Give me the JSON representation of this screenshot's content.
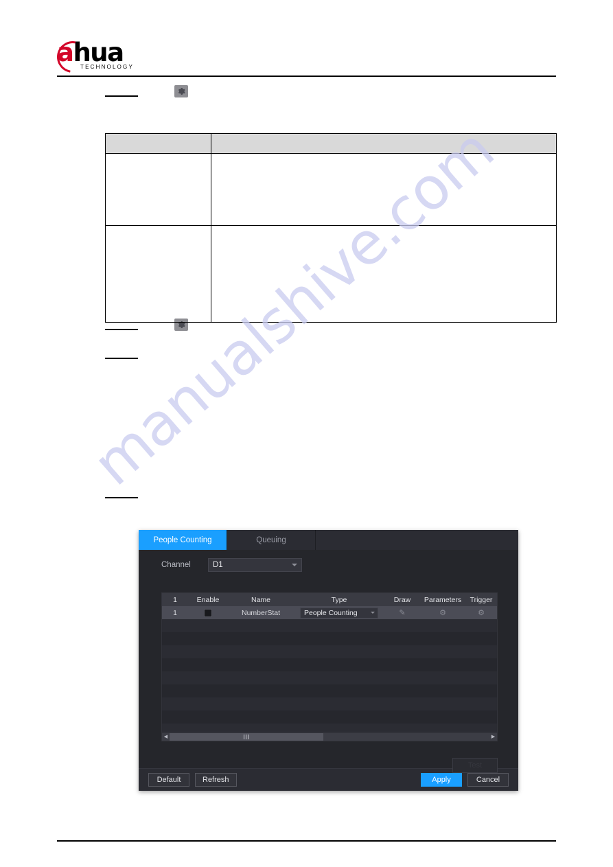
{
  "document": {
    "brand": {
      "name_prefix": "a",
      "name_rest": "hua",
      "tagline": "TECHNOLOGY"
    },
    "watermark": "manualshive.com",
    "table": {
      "header_cells": [
        "",
        ""
      ],
      "rows": [
        {
          "cells": [
            "",
            ""
          ]
        },
        {
          "cells": [
            "",
            ""
          ]
        }
      ]
    },
    "inline_icons": [
      {
        "name": "gear-icon"
      },
      {
        "name": "gear-icon"
      }
    ]
  },
  "nvr": {
    "tabs": [
      {
        "label": "People Counting",
        "active": true
      },
      {
        "label": "Queuing",
        "active": false
      }
    ],
    "channel": {
      "label": "Channel",
      "value": "D1"
    },
    "grid": {
      "headers": {
        "index": "1",
        "enable": "Enable",
        "name": "Name",
        "type": "Type",
        "draw": "Draw",
        "parameters": "Parameters",
        "trigger": "Trigger"
      },
      "rows": [
        {
          "index": "1",
          "enabled": false,
          "name": "NumberStat",
          "type": "People Counting",
          "draw_icon": "pencil-icon",
          "parameters_icon": "gear-icon",
          "trigger_icon": "gear-icon"
        }
      ],
      "empty_row_count": 9
    },
    "test_button": "Test",
    "footer": {
      "default_label": "Default",
      "refresh_label": "Refresh",
      "apply_label": "Apply",
      "cancel_label": "Cancel"
    },
    "colors": {
      "accent": "#1a9fff",
      "panel_bg": "#25262b",
      "header_bg": "#3a3b43",
      "selected_row": "#4b4c56"
    }
  }
}
